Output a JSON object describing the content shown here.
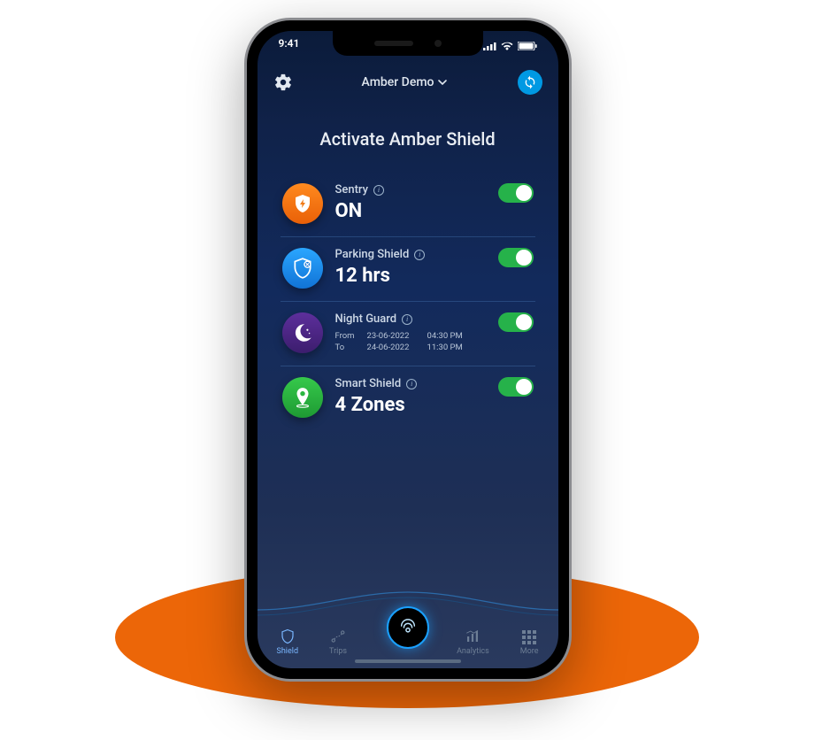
{
  "status": {
    "time": "9:41"
  },
  "header": {
    "device_name": "Amber Demo"
  },
  "title": "Activate Amber Shield",
  "sentry": {
    "label": "Sentry",
    "value": "ON",
    "on": true
  },
  "parking": {
    "label": "Parking Shield",
    "value": "12 hrs",
    "on": true
  },
  "night": {
    "label": "Night Guard",
    "from_label": "From",
    "from_date": "23-06-2022",
    "from_time": "04:30 PM",
    "to_label": "To",
    "to_date": "24-06-2022",
    "to_time": "11:30 PM",
    "on": true
  },
  "smart": {
    "label": "Smart Shield",
    "value": "4 Zones",
    "on": true
  },
  "nav": {
    "shield": "Shield",
    "trips": "Trips",
    "analytics": "Analytics",
    "more": "More"
  }
}
